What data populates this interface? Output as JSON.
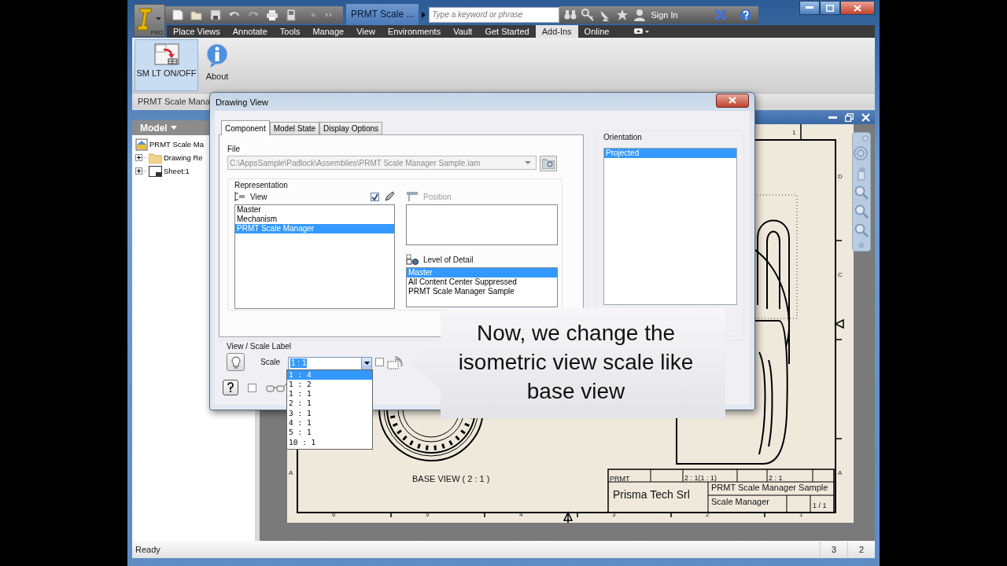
{
  "app_window": {
    "edition": "PRO",
    "title": "PRMT Scale ...",
    "search": {
      "placeholder": "Type a keyword or phrase"
    },
    "sign_in": "Sign In"
  },
  "ribbon_tabs": [
    {
      "label": "Place Views",
      "selected": false
    },
    {
      "label": "Annotate",
      "selected": false
    },
    {
      "label": "Tools",
      "selected": false
    },
    {
      "label": "Manage",
      "selected": false
    },
    {
      "label": "View",
      "selected": false
    },
    {
      "label": "Environments",
      "selected": false
    },
    {
      "label": "Vault",
      "selected": false
    },
    {
      "label": "Get Started",
      "selected": false
    },
    {
      "label": "Add-Ins",
      "selected": true
    },
    {
      "label": "Online",
      "selected": false
    }
  ],
  "ribbon_buttons": [
    {
      "label": "SM LT ON/OFF",
      "kind": "scale",
      "selected": true
    },
    {
      "label": "About",
      "kind": "info",
      "selected": false
    }
  ],
  "ribbon_panel_title": "PRMT Scale Mana",
  "browser": {
    "header": "Model",
    "tree": [
      {
        "label": "PRMT Scale Ma",
        "kind": "document",
        "children": [
          {
            "label": "Drawing Re",
            "kind": "folder",
            "expanded": false
          },
          {
            "label": "Sheet:1",
            "kind": "sheet",
            "expanded": false
          }
        ]
      }
    ]
  },
  "drawing": {
    "zone_labels": [
      "1",
      "D",
      "C",
      "A",
      "A",
      "6",
      "5",
      "4",
      "3",
      "2",
      "1"
    ],
    "view_label": "BASE VIEW ( 2 : 1 )",
    "title_block": {
      "drawn_by": "PRMT",
      "scale": "2 : 1(1 : 1)",
      "view_scale": "2 : 1",
      "company": "Prisma Tech Srl",
      "title": "PRMT Scale Manager Sample",
      "subtitle": "Scale Manager",
      "sheet": "1 / 1"
    }
  },
  "dialog": {
    "title": "Drawing View",
    "tabs": [
      {
        "label": "Component",
        "selected": true
      },
      {
        "label": "Model State",
        "selected": false
      },
      {
        "label": "Display Options",
        "selected": false
      }
    ],
    "file": {
      "label": "File",
      "value": "C:\\AppsSample\\Padlock\\Assemblies\\PRMT Scale Manager Sample.iam",
      "disabled": true
    },
    "representation": {
      "label": "Representation",
      "view": {
        "label": "View",
        "checked": true,
        "items": [
          {
            "label": "Master",
            "selected": false
          },
          {
            "label": "Mechanism",
            "selected": false
          },
          {
            "label": "PRMT Scale Manager",
            "selected": true
          }
        ]
      },
      "position": {
        "label": "Position",
        "disabled": true
      },
      "level_of_detail": {
        "label": "Level of Detail",
        "items": [
          {
            "label": "Master",
            "selected": true
          },
          {
            "label": "All Content Center Suppressed",
            "selected": false
          },
          {
            "label": "PRMT Scale Manager Sample",
            "selected": false
          }
        ]
      }
    },
    "orientation": {
      "label": "Orientation",
      "items": [
        {
          "label": "Projected",
          "selected": true
        }
      ]
    },
    "scale_label": {
      "label": "View / Scale Label",
      "scale_text": "Scale",
      "scale_value": "1 : 1",
      "expanded": true,
      "visible_checked": false,
      "options": [
        {
          "label": "1 : 4",
          "selected": true
        },
        {
          "label": "1 : 2",
          "selected": false
        },
        {
          "label": "1 : 1",
          "selected": false
        },
        {
          "label": "2 : 1",
          "selected": false
        },
        {
          "label": "3 : 1",
          "selected": false
        },
        {
          "label": "4 : 1",
          "selected": false
        },
        {
          "label": "5 : 1",
          "selected": false
        },
        {
          "label": "10 : 1",
          "selected": false
        }
      ]
    },
    "trails_checked": false
  },
  "callout": {
    "text": "Now, we change the isometric view scale like base view"
  },
  "status_bar": {
    "text": "Ready",
    "cells": [
      "3",
      "2"
    ]
  }
}
